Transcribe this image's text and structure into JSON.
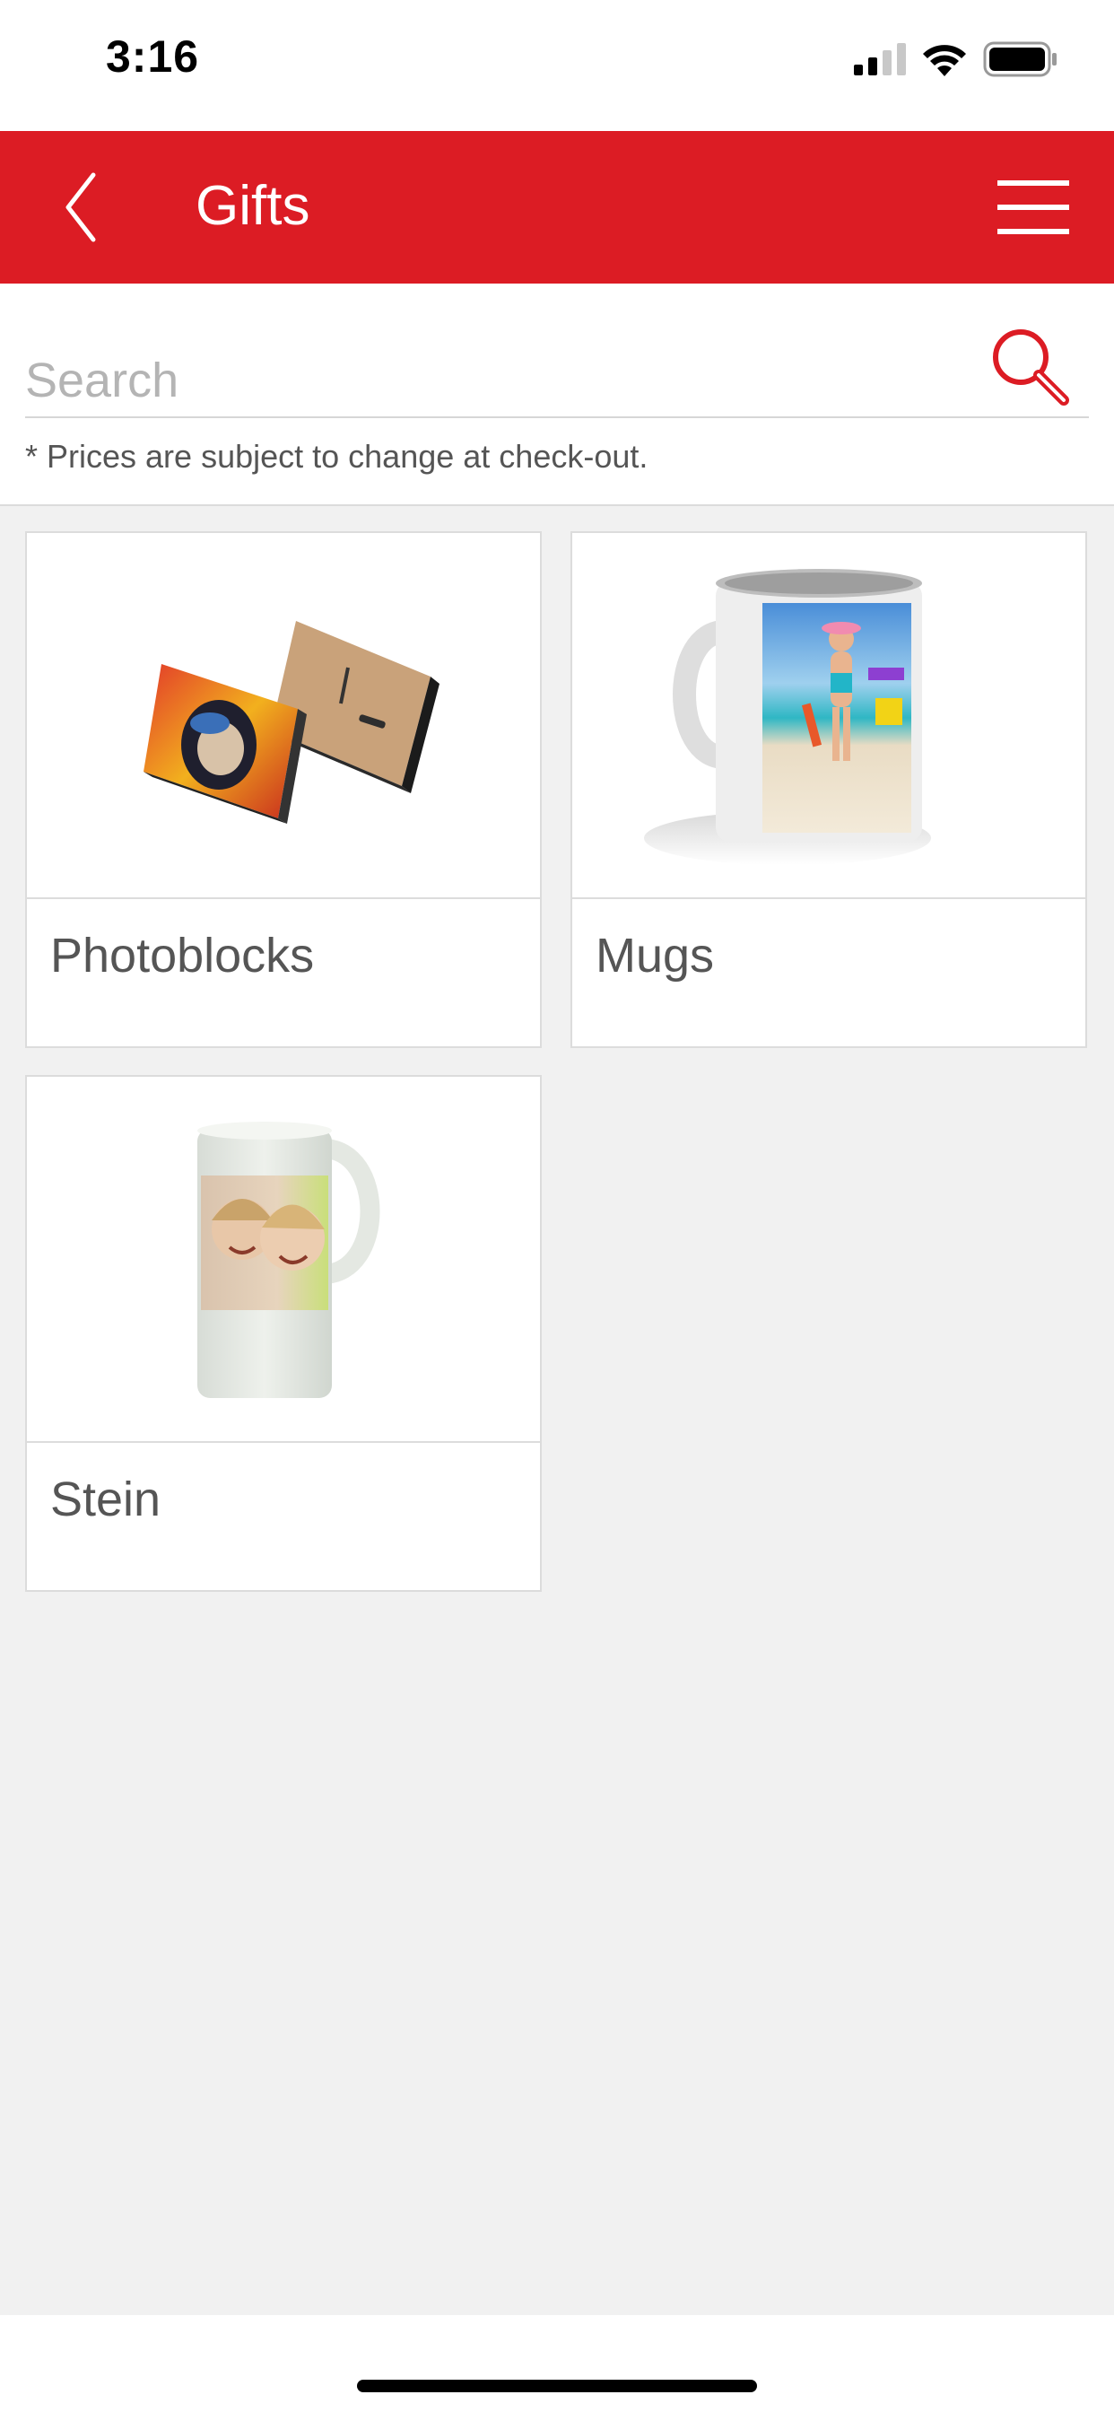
{
  "status_bar": {
    "time": "3:16",
    "icons": [
      "cellular-signal-icon",
      "wifi-icon",
      "battery-icon"
    ]
  },
  "header": {
    "title": "Gifts",
    "back_icon": "chevron-left-icon",
    "menu_icon": "hamburger-menu-icon",
    "background_color": "#dc1c24"
  },
  "search": {
    "placeholder": "Search",
    "value": "",
    "icon": "search-icon",
    "note": "* Prices are subject to change at check-out."
  },
  "products": [
    {
      "label": "Photoblocks"
    },
    {
      "label": "Mugs"
    },
    {
      "label": "Stein"
    }
  ]
}
